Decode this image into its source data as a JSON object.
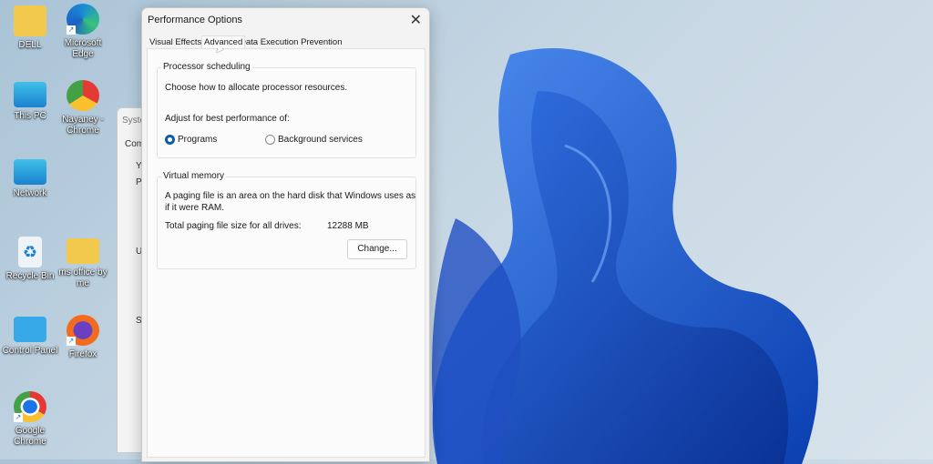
{
  "desktop": {
    "icons": [
      {
        "label": "DELL",
        "icon": "folder-user-icon"
      },
      {
        "label": "Microsoft Edge",
        "icon": "edge-icon"
      },
      {
        "label": "This PC",
        "icon": "monitor-icon"
      },
      {
        "label": "Nayaney - Chrome",
        "icon": "chrome-profile-icon"
      },
      {
        "label": "Network",
        "icon": "network-icon"
      },
      {
        "label": "Recycle Bin",
        "icon": "recycle-bin-icon"
      },
      {
        "label": "ms office by me",
        "icon": "folder-icon"
      },
      {
        "label": "Control Panel",
        "icon": "control-panel-icon"
      },
      {
        "label": "Firefox",
        "icon": "firefox-icon"
      },
      {
        "label": "Google Chrome",
        "icon": "chrome-icon"
      }
    ]
  },
  "background_window": {
    "title": "Syste",
    "line1": "Com",
    "l2": "Y",
    "l3": "P",
    "l4": "U",
    "l5": "S"
  },
  "dialog": {
    "title": "Performance Options",
    "tabs": [
      "Visual Effects",
      "Advanced",
      "Data Execution Prevention"
    ],
    "active_tab": "Advanced",
    "processor": {
      "heading": "Processor scheduling",
      "desc": "Choose how to allocate processor resources.",
      "adjust": "Adjust for best performance of:",
      "options": [
        "Programs",
        "Background services"
      ],
      "selected": "Programs"
    },
    "virtual_memory": {
      "heading": "Virtual memory",
      "desc1": "A paging file is an area on the hard disk that Windows uses as",
      "desc2": "if it were RAM.",
      "total_label": "Total paging file size for all drives:",
      "total_value": "12288 MB",
      "change_button": "Change..."
    }
  },
  "colors": {
    "accent": "#0b5cad",
    "bloom": "#1a5fd6"
  }
}
